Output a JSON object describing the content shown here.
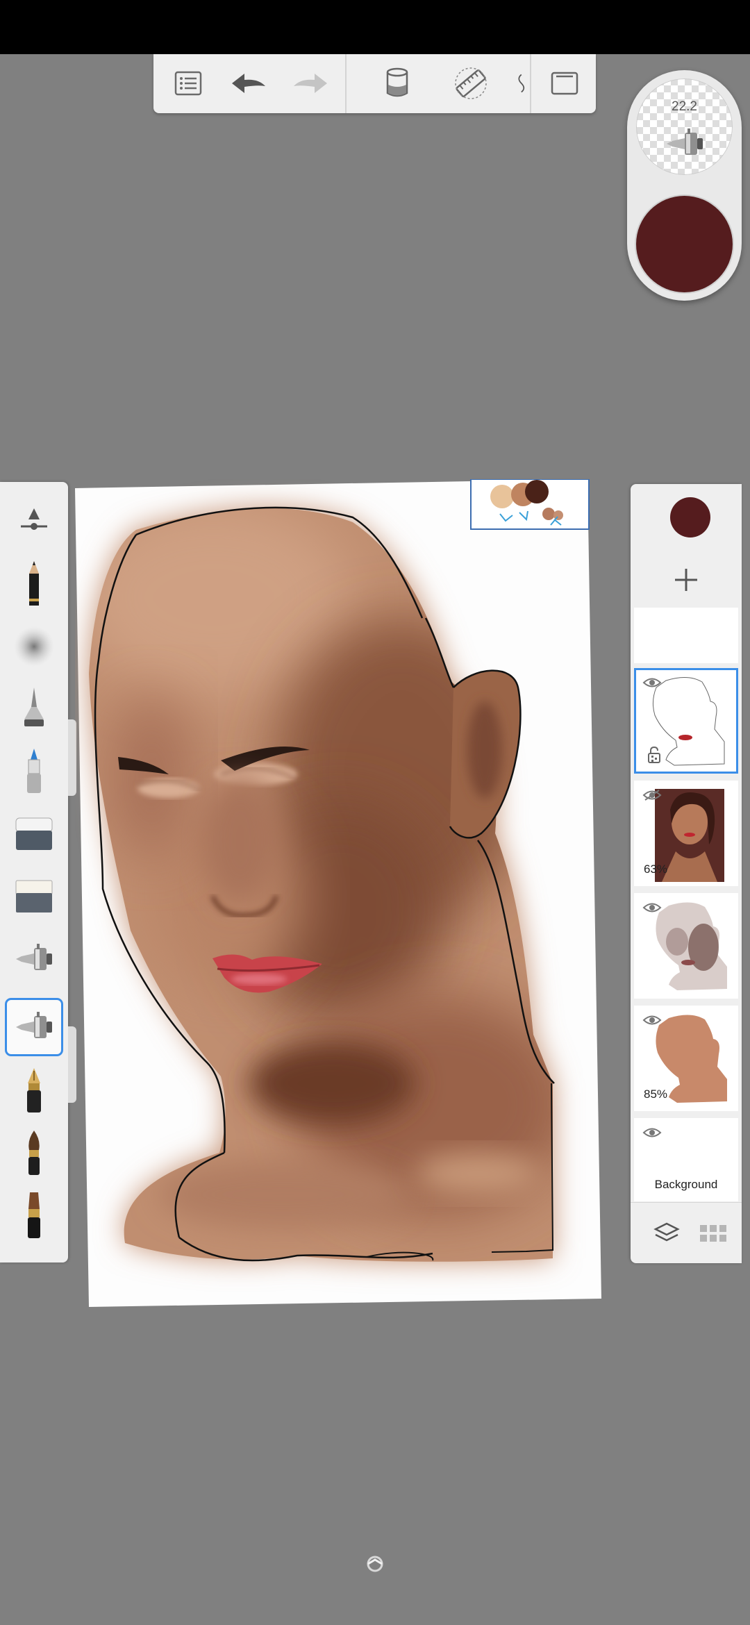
{
  "app": {
    "accent_color": "#3b8ee8",
    "primary_color": "#551c1e",
    "canvas_background": "#808080"
  },
  "toolbar": {
    "items": [
      {
        "name": "list-icon"
      },
      {
        "name": "undo-icon"
      },
      {
        "name": "redo-icon"
      },
      {
        "name": "fill-bucket-icon"
      },
      {
        "name": "ruler-icon"
      },
      {
        "name": "selection-icon"
      },
      {
        "name": "fullscreen-icon"
      }
    ]
  },
  "brush_puck": {
    "size": "22.2",
    "color": "#551c1e"
  },
  "brushes": [
    {
      "name": "brush-size-slider-icon"
    },
    {
      "name": "pencil-icon"
    },
    {
      "name": "spray-texture-icon"
    },
    {
      "name": "airbrush-cone-icon"
    },
    {
      "name": "marker-icon"
    },
    {
      "name": "hard-eraser-icon"
    },
    {
      "name": "soft-eraser-icon"
    },
    {
      "name": "airbrush-icon"
    },
    {
      "name": "soft-airbrush-icon",
      "selected": true
    },
    {
      "name": "ink-pen-icon"
    },
    {
      "name": "paint-brush-icon"
    },
    {
      "name": "flat-brush-icon"
    }
  ],
  "layers": {
    "current_color": "#551c1e",
    "items": [
      {
        "name": "empty-layer"
      },
      {
        "name": "line-art-layer",
        "active": true,
        "locked": true
      },
      {
        "name": "reference-photo-layer",
        "opacity": "63%",
        "hidden": true
      },
      {
        "name": "shading-layer"
      },
      {
        "name": "base-skin-layer",
        "opacity": "85%"
      },
      {
        "name": "background-layer",
        "label": "Background"
      }
    ]
  }
}
